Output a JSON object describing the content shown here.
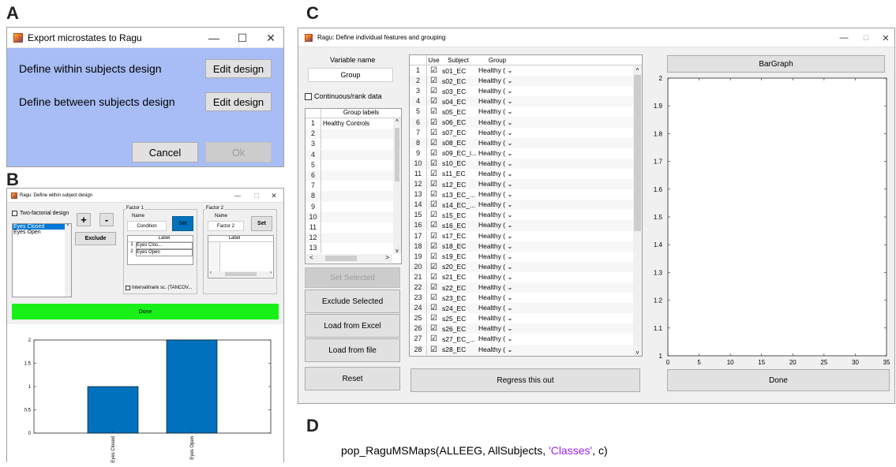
{
  "labels": {
    "a": "A",
    "b": "B",
    "c": "C",
    "d": "D"
  },
  "panelA": {
    "title": "Export microstates to Ragu",
    "within_label": "Define within subjects design",
    "between_label": "Define between subjects design",
    "edit1": "Edit design",
    "edit2": "Edit design",
    "cancel": "Cancel",
    "ok": "Ok",
    "bg": "#a8bdf5"
  },
  "panelB": {
    "title": "Ragu: Define within subject design",
    "two_factorial": "Two-factorial design",
    "levels": [
      "Eyes Closed",
      "Eyes Open"
    ],
    "plus": "+",
    "minus": "-",
    "exclude": "Exclude",
    "factor1": {
      "legend": "Factor 1",
      "name_label": "Name",
      "name": "Condition",
      "set": "Set",
      "col": "Label",
      "rows": [
        {
          "n": "1",
          "v": "Eyes Clos..."
        },
        {
          "n": "2",
          "v": "Eyes Open"
        }
      ]
    },
    "factor2": {
      "legend": "Factor 2",
      "name_label": "Name",
      "name": "Factor 2",
      "set": "Set",
      "col": "Label"
    },
    "interval": "Intervall/rank sc. (TANCOV...",
    "done": "Done",
    "done_color": "#19f019"
  },
  "panelC": {
    "title": "Ragu: Define individual features and grouping",
    "varname_label": "Variable name",
    "varname": "Group",
    "continuous": "Continuous/rank data",
    "group_labels_header": "Group labels",
    "group_labels": [
      "Healthy Controls",
      "",
      "",
      "",
      "",
      "",
      "",
      "",
      "",
      "",
      "",
      "",
      ""
    ],
    "table_headers": {
      "use": "Use",
      "subject": "Subject",
      "group": "Group"
    },
    "subjects": [
      "s01_EC",
      "s02_EC",
      "s03_EC",
      "s04_EC",
      "s05_EC",
      "s06_EC",
      "s07_EC",
      "s08_EC",
      "s09_EC_i...",
      "s10_EC",
      "s11_EC",
      "s12_EC",
      "s13_EC_...",
      "s14_EC_...",
      "s15_EC",
      "s16_EC",
      "s17_EC",
      "s18_EC",
      "s19_EC",
      "s20_EC",
      "s21_EC",
      "s22_EC",
      "s23_EC",
      "s24_EC",
      "s25_EC",
      "s26_EC",
      "s27_EC_...",
      "s28_EC"
    ],
    "group_value": "Healthy (",
    "set_selected": "Set Selected",
    "exclude_selected": "Exclude Selected",
    "load_excel": "Load from Excel",
    "load_file": "Load from file",
    "reset": "Reset",
    "regress": "Regress this out",
    "bargraph": "BarGraph",
    "done": "Done"
  },
  "panelD": {
    "code_prefix": "pop_RaguMSMaps(ALLEEG, AllSubjects, ",
    "code_string": "'Classes'",
    "code_suffix": ", c)",
    "string_color": "#a020f0"
  },
  "chart_data": [
    {
      "type": "bar",
      "categories": [
        "Eyes Closed",
        "Eyes Open"
      ],
      "values": [
        1,
        2
      ],
      "ylim": [
        0,
        2
      ],
      "yticks": [
        "0",
        "0.5",
        "1",
        "1.5",
        "2"
      ],
      "color": "#0072bd"
    },
    {
      "type": "line",
      "xlim": [
        0,
        35
      ],
      "ylim": [
        1,
        2
      ],
      "xticks": [
        "0",
        "5",
        "10",
        "15",
        "20",
        "25",
        "30",
        "35"
      ],
      "yticks": [
        "1",
        "1.1",
        "1.2",
        "1.3",
        "1.4",
        "1.5",
        "1.6",
        "1.7",
        "1.8",
        "1.9",
        "2"
      ],
      "series": []
    }
  ]
}
